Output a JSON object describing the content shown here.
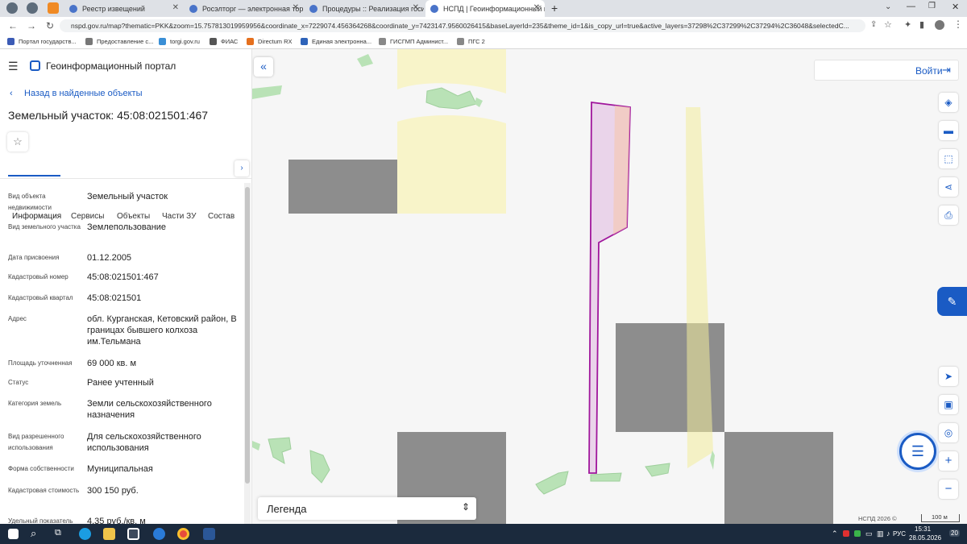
{
  "browser": {
    "tabs": [
      {
        "label": "Реестр извещений"
      },
      {
        "label": "Росэлторг — электронная торгов"
      },
      {
        "label": "Процедуры :: Реализация госим"
      },
      {
        "label": "НСПД | Геоинформационный п"
      }
    ],
    "new_tab": "+",
    "url": "nspd.gov.ru/map?thematic=PKK&zoom=15.757813019959956&coordinate_x=7229074.456364268&coordinate_y=7423147.9560026415&baseLayerId=235&theme_id=1&is_copy_url=true&active_layers=37298%2C37299%2C37294%2C36048&selectedC...",
    "bookmarks": [
      "Портал государств...",
      "Предоставление с...",
      "torgi.gov.ru",
      "ФИАС",
      "Directum RX",
      "Единая электронна...",
      "ГИСГМП Админист...",
      "ПГС 2"
    ]
  },
  "portal": {
    "title": "Геоинформационный портал",
    "back_link": "Назад в найденные объекты",
    "object_title": "Земельный участок: 45:08:021501:467",
    "tabs": [
      "Информация",
      "Сервисы",
      "Объекты",
      "Части ЗУ",
      "Состав"
    ],
    "fields": [
      {
        "label": "Вид объекта недвижимости",
        "value": "Земельный участок"
      },
      {
        "label": "Вид земельного участка",
        "value": "Землепользование"
      },
      {
        "label": "Дата присвоения",
        "value": "01.12.2005"
      },
      {
        "label": "Кадастровый номер",
        "value": "45:08:021501:467"
      },
      {
        "label": "Кадастровый квартал",
        "value": "45:08:021501"
      },
      {
        "label": "Адрес",
        "value": "обл. Курганская, Кетовский район, В границах бывшего колхоза им.Тельмана"
      },
      {
        "label": "Площадь уточненная",
        "value": "69 000 кв. м"
      },
      {
        "label": "Статус",
        "value": "Ранее учтенный"
      },
      {
        "label": "Категория земель",
        "value": "Земли сельскохозяйственного назначения"
      },
      {
        "label": "Вид разрешенного использования",
        "value": "Для сельскохозяйственного использования"
      },
      {
        "label": "Форма собственности",
        "value": "Муниципальная"
      },
      {
        "label": "Кадастровая стоимость",
        "value": "300 150 руб."
      },
      {
        "label": "Удельный показатель",
        "value": "4,35 руб./кв. м"
      }
    ]
  },
  "map": {
    "login": "Войти",
    "legend": "Легенда",
    "attribution": "НСПД 2026 ©",
    "scale": "100 м"
  },
  "taskbar": {
    "lang": "РУС",
    "time": "15:31",
    "date": "28.05.2026",
    "notif": "20"
  },
  "colors": {
    "accent": "#1a5bc4",
    "parcel_stroke": "#a0169c",
    "parcel_fill": "#e6c8e6",
    "field_yellow": "#f8f4c9",
    "forest_green": "#b9e2b6",
    "building_gray": "#8d8d8d"
  }
}
